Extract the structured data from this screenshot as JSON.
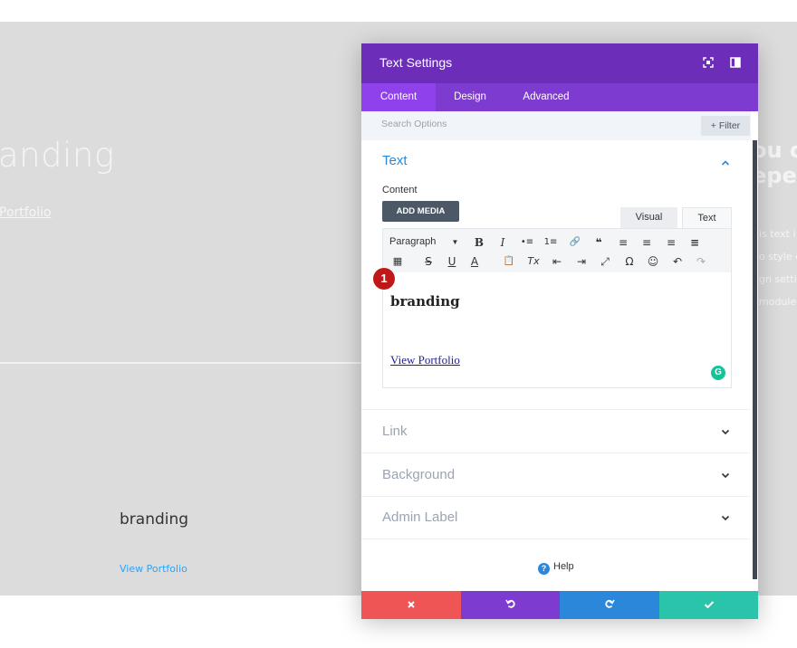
{
  "background": {
    "heading": "anding",
    "link": "Portfolio",
    "right_heading_1": "ou c",
    "right_heading_2": "epe",
    "right_lines": [
      "is text i",
      "o style e",
      "gn setti",
      "module"
    ],
    "card_title": "branding",
    "card_link": "View Portfolio"
  },
  "modal": {
    "title": "Text Settings",
    "tabs": [
      {
        "label": "Content",
        "active": true
      },
      {
        "label": "Design",
        "active": false
      },
      {
        "label": "Advanced",
        "active": false
      }
    ],
    "search": {
      "placeholder": "Search Options"
    },
    "filter_label": "+ Filter",
    "sections": {
      "text": {
        "title": "Text",
        "expanded": true
      },
      "link": {
        "title": "Link"
      },
      "background": {
        "title": "Background"
      },
      "admin_label": {
        "title": "Admin Label"
      }
    },
    "content_label": "Content",
    "add_media_label": "ADD MEDIA",
    "editor_modes": {
      "visual": "Visual",
      "text": "Text"
    },
    "toolbar": {
      "paragraph": "Paragraph",
      "row1": [
        "B",
        "I",
        "•≡",
        "1≡",
        "🔗",
        "❝",
        "≡",
        "≡",
        "≡",
        "≡"
      ],
      "row2": [
        "▦",
        "S",
        "U",
        "A",
        "📋",
        "Tx",
        "⇤",
        "⇥",
        "⤢",
        "Ω",
        "☺",
        "↶",
        "↷"
      ]
    },
    "editor_content": {
      "heading": "branding",
      "link": "View Portfolio"
    },
    "badge": "1",
    "help_label": "Help",
    "colors": {
      "header": "#6c2eb9",
      "tabs": "#7e3bd0",
      "active_tab": "#8f42ec",
      "cancel": "#ef5555",
      "undo": "#7e3bd0",
      "redo": "#2b87da",
      "save": "#29c4a9"
    }
  }
}
